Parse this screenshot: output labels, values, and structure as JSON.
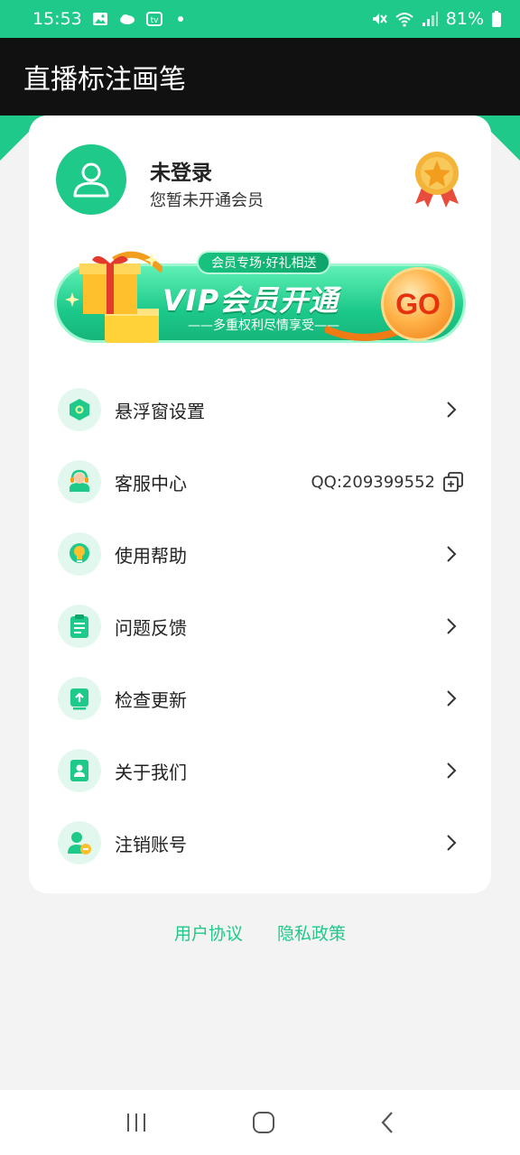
{
  "status_bar": {
    "time": "15:53",
    "battery": "81%",
    "icons": [
      "gallery-icon",
      "cloud-icon",
      "tv-icon",
      "notification-dot",
      "mute-icon",
      "wifi-icon",
      "signal-icon",
      "battery-icon"
    ]
  },
  "app": {
    "title": "直播标注画笔",
    "accent_color": "#1ec989"
  },
  "profile": {
    "name": "未登录",
    "subtitle": "您暂未开通会员"
  },
  "vip_banner": {
    "tag": "会员专场·好礼相送",
    "title": "VIP会员开通",
    "subtitle": "——多重权利尽情享受——",
    "go": "GO"
  },
  "menu": [
    {
      "label": "悬浮窗设置",
      "icon": "floating-window-icon"
    },
    {
      "label": "客服中心",
      "icon": "customer-service-icon",
      "value": "QQ:209399552"
    },
    {
      "label": "使用帮助",
      "icon": "lightbulb-icon"
    },
    {
      "label": "问题反馈",
      "icon": "clipboard-icon"
    },
    {
      "label": "检查更新",
      "icon": "upload-icon"
    },
    {
      "label": "关于我们",
      "icon": "person-card-icon"
    },
    {
      "label": "注销账号",
      "icon": "user-remove-icon"
    }
  ],
  "links": {
    "user_agreement": "用户协议",
    "privacy_policy": "隐私政策"
  }
}
